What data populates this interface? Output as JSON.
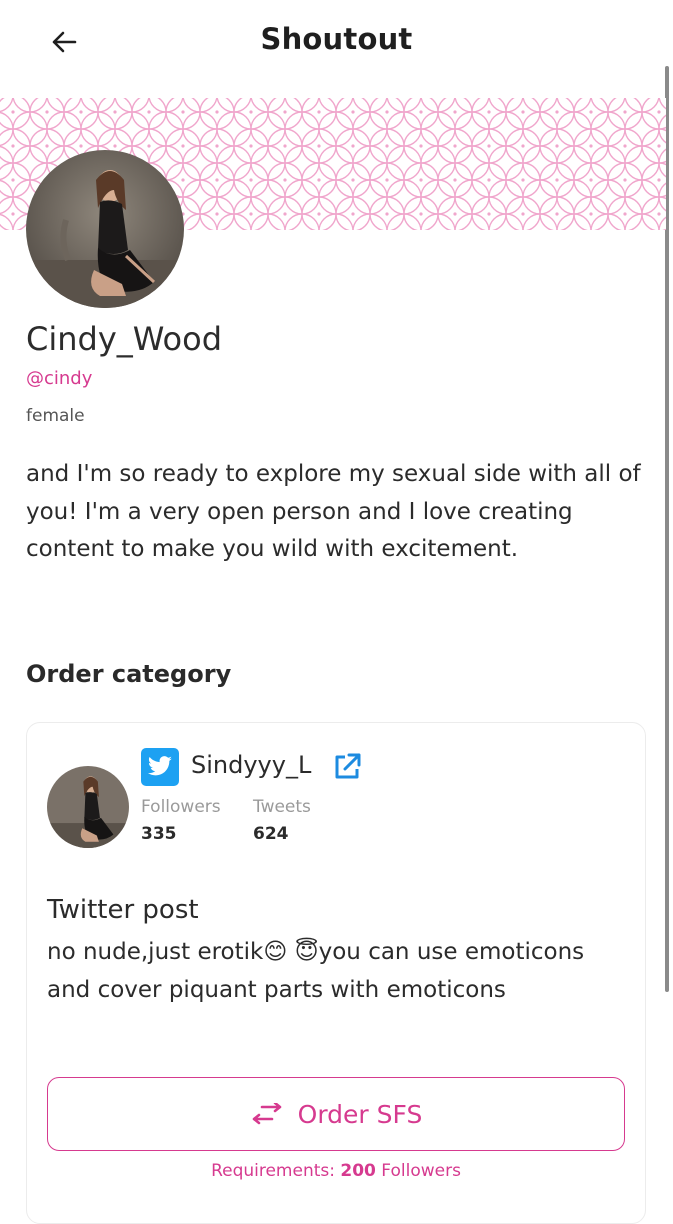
{
  "header": {
    "title": "Shoutout",
    "back_icon": "arrow-left-icon"
  },
  "profile": {
    "display_name": "Cindy_Wood",
    "handle": "@cindy",
    "gender": "female",
    "bio": "and I'm so ready to explore my sexual side with all of you! I'm a very open person and I love creating content to make you wild with excitement."
  },
  "order_section": {
    "title": "Order category"
  },
  "card": {
    "platform_icon": "twitter-icon",
    "account_name": "Sindyyy_L",
    "external_icon": "external-link-icon",
    "followers_label": "Followers",
    "followers_value": "335",
    "tweets_label": "Tweets",
    "tweets_value": "624",
    "post_title": "Twitter post",
    "post_description": "no nude,just erotik😊 😇you can use emoticons and cover piquant parts with emoticons",
    "order_button_label": "Order SFS",
    "requirements_prefix": "Requirements: ",
    "requirements_value": "200",
    "requirements_suffix": " Followers"
  },
  "colors": {
    "accent": "#d63a8f",
    "twitter_blue": "#1da1f2",
    "banner_pattern": "#f0a6cc"
  }
}
